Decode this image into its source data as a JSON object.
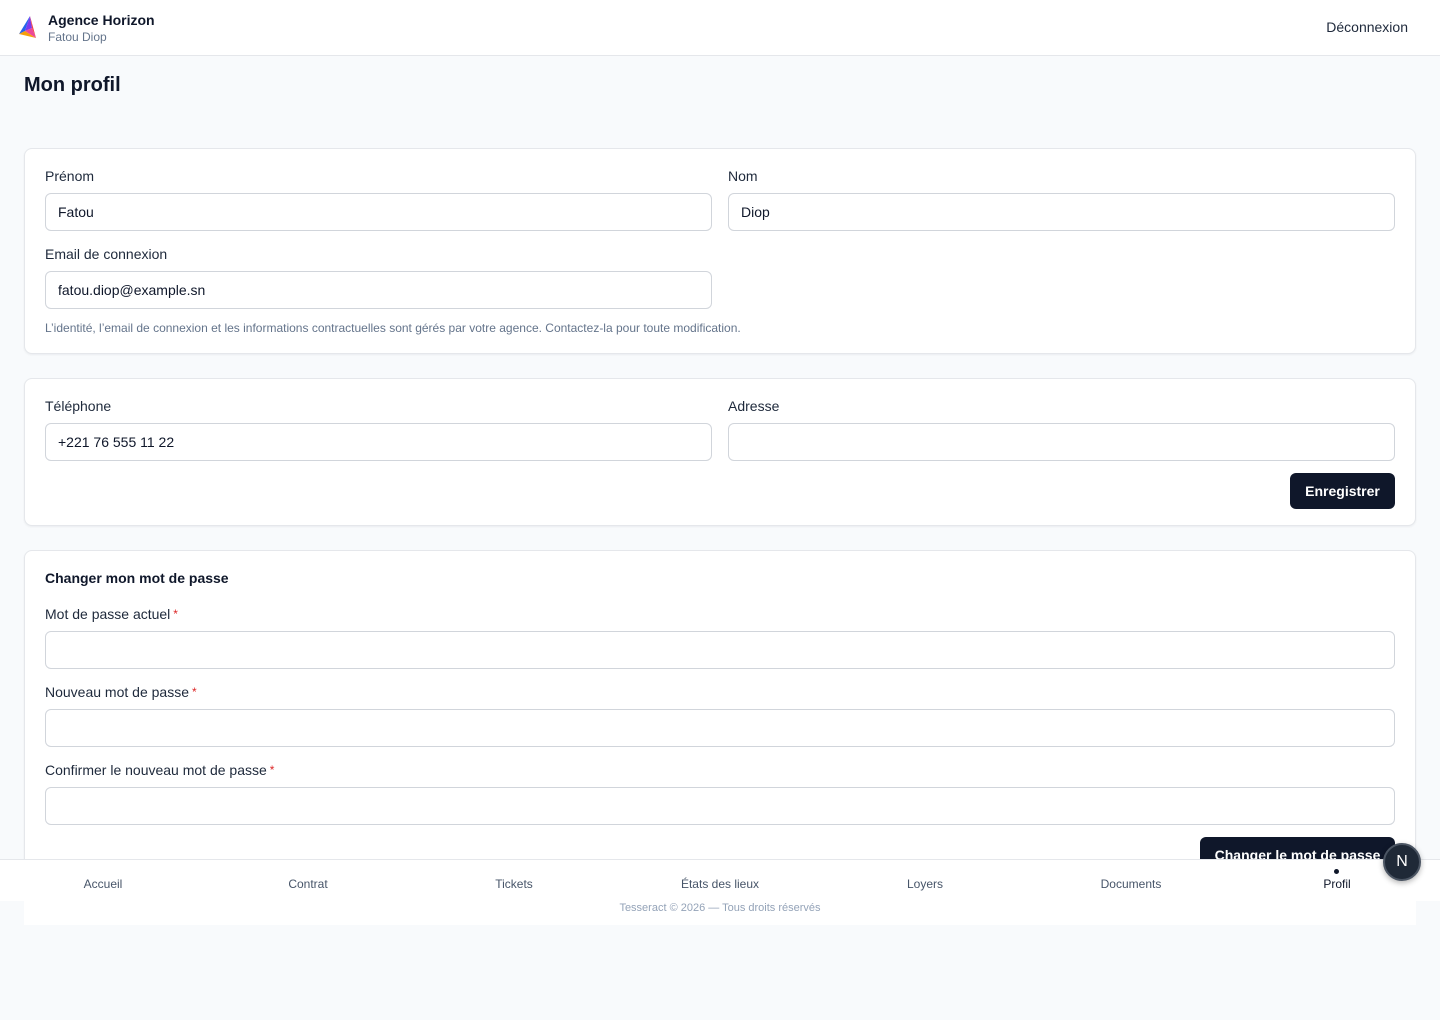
{
  "header": {
    "agency_name": "Agence Horizon",
    "user_name": "Fatou Diop",
    "logout_label": "Déconnexion"
  },
  "page": {
    "title": "Mon profil"
  },
  "identity": {
    "first_name_label": "Prénom",
    "first_name_value": "Fatou",
    "last_name_label": "Nom",
    "last_name_value": "Diop",
    "email_label": "Email de connexion",
    "email_value": "fatou.diop@example.sn",
    "help_text": "L’identité, l’email de connexion et les informations contractuelles sont gérés par votre agence. Contactez-la pour toute modification."
  },
  "contact": {
    "phone_label": "Téléphone",
    "phone_value": "+221 76 555 11 22",
    "address_label": "Adresse",
    "address_value": "",
    "save_label": "Enregistrer"
  },
  "password": {
    "section_title": "Changer mon mot de passe",
    "current_label": "Mot de passe actuel",
    "new_label": "Nouveau mot de passe",
    "confirm_label": "Confirmer le nouveau mot de passe",
    "required_mark": "*",
    "submit_label": "Changer le mot de passe"
  },
  "bottom_nav": {
    "items": [
      {
        "label": "Accueil"
      },
      {
        "label": "Contrat"
      },
      {
        "label": "Tickets"
      },
      {
        "label": "États des lieux"
      },
      {
        "label": "Loyers"
      },
      {
        "label": "Documents"
      },
      {
        "label": "Profil"
      }
    ],
    "active": "Profil"
  },
  "footer": {
    "copyright": "Tesseract © 2026 — Tous droits réservés"
  },
  "floating_button": {
    "label": "N"
  },
  "colors": {
    "primary": "#0f172a",
    "required": "#dc2626",
    "muted": "#64748b",
    "border": "#e5e7eb"
  }
}
